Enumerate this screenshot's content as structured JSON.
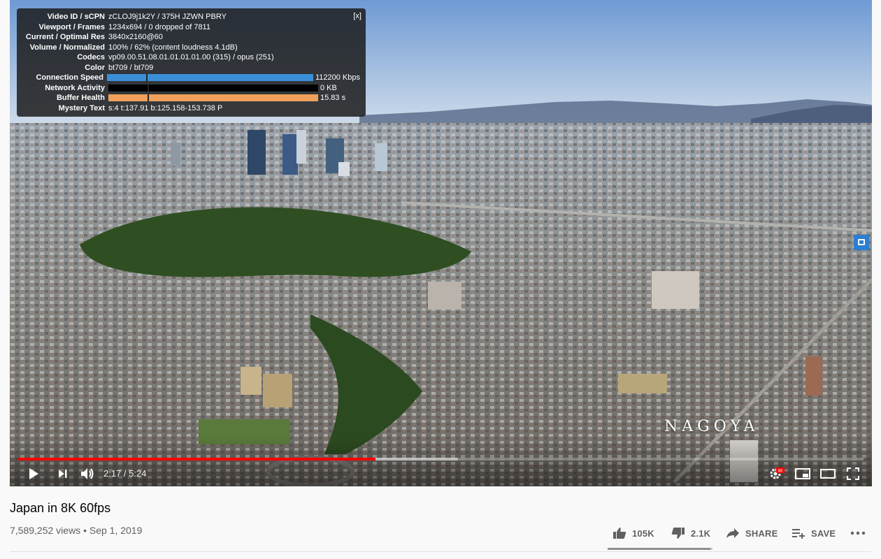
{
  "stats": {
    "close_label": "[x]",
    "rows": [
      {
        "key": "Video ID / sCPN",
        "value": "zCLOJ9j1k2Y / 375H JZWN PBRY"
      },
      {
        "key": "Viewport / Frames",
        "value": "1234x694 / 0 dropped of 7811"
      },
      {
        "key": "Current / Optimal Res",
        "value": "3840x2160@60"
      },
      {
        "key": "Volume / Normalized",
        "value": "100% / 62% (content loudness 4.1dB)"
      },
      {
        "key": "Codecs",
        "value": "vp09.00.51.08.01.01.01.01.00 (315) / opus (251)"
      },
      {
        "key": "Color",
        "value": "bt709 / bt709"
      }
    ],
    "bars": [
      {
        "key": "Connection Speed",
        "value": "112200 Kbps",
        "fill": 1.0,
        "color": "#3b8fd9"
      },
      {
        "key": "Network Activity",
        "value": "0 KB",
        "fill": 0.0,
        "color": "#3b8fd9"
      },
      {
        "key": "Buffer Health",
        "value": "15.83 s",
        "fill": 1.0,
        "color": "#f0a05a"
      }
    ],
    "mystery": {
      "key": "Mystery Text",
      "value": "s:4 t:137.91 b:125.158-153.738 P"
    }
  },
  "overlay_text": "NAGOYA",
  "player": {
    "current_time": "2:17",
    "duration": "5:24",
    "time_display": "2:17 / 5:24",
    "played_fraction": 0.4228,
    "loaded_fraction": 0.52,
    "quality_badge": "4K",
    "colors": {
      "played": "#ff0000"
    }
  },
  "video": {
    "title": "Japan in 8K 60fps",
    "views": "7,589,252 views",
    "date": "Sep 1, 2019",
    "meta": "7,589,252 views • Sep 1, 2019"
  },
  "actions": {
    "likes": "105K",
    "dislikes": "2.1K",
    "share": "SHARE",
    "save": "SAVE"
  }
}
